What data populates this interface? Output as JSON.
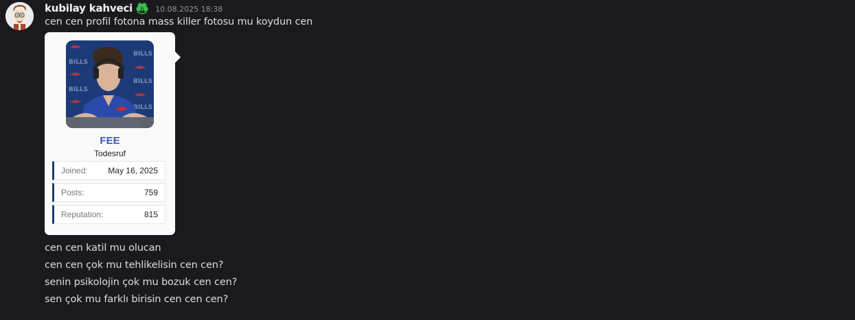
{
  "message": {
    "username": "kubilay kahveci",
    "role_icon": "green-clover-role-icon",
    "timestamp": "10.08.2025 18:38",
    "first_line": "cen cen profil fotona mass killer fotosu mu koydun cen",
    "lines": [
      "cen cen katil mu olucan",
      "cen cen çok mu tehlikelisin cen cen?",
      "senin psikolojin çok mu bozuk cen cen?",
      "sen çok mu farklı birisin cen cen cen?"
    ]
  },
  "profile_card": {
    "photo": "profile-photo",
    "photo_backdrop_text": "BILLS",
    "name": "FEE",
    "subtitle": "Todesruf",
    "stats": [
      {
        "label": "Joined:",
        "value": "May 16, 2025"
      },
      {
        "label": "Posts:",
        "value": "759"
      },
      {
        "label": "Reputation:",
        "value": "815"
      }
    ]
  },
  "colors": {
    "background": "#1a1a1e",
    "username": "#f2f3f5",
    "card_name": "#3b58b8",
    "stat_accent": "#1e3a6e",
    "role_icon": "#3fb950"
  }
}
